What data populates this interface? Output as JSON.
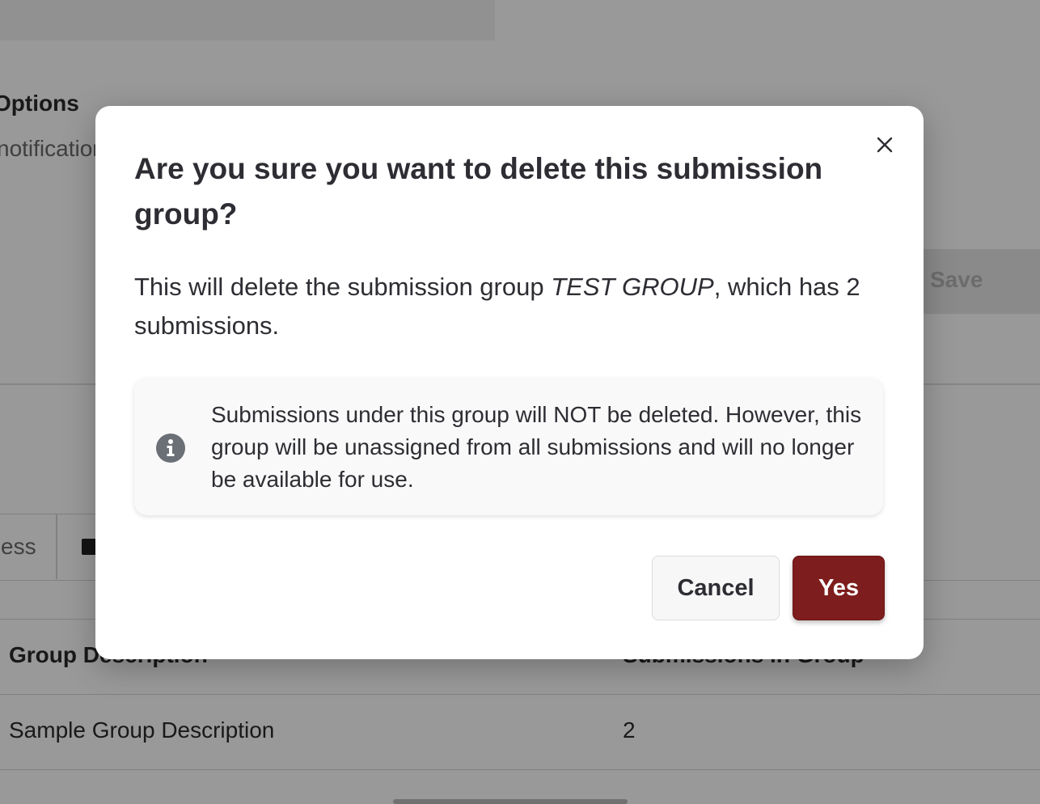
{
  "background": {
    "section_title": "Options",
    "section_subtitle": "notifications",
    "save_label": "Save",
    "tab_partial_label": "ess",
    "table": {
      "headers": [
        "Group Description",
        "Submissions in Group"
      ],
      "rows": [
        [
          "Sample Group Description",
          "2"
        ]
      ]
    }
  },
  "modal": {
    "title": "Are you sure you want to delete this submission group?",
    "body_prefix": "This will delete the submission group ",
    "group_name": "TEST GROUP",
    "body_suffix": ", which has 2 submissions.",
    "info_text": "Submissions under this group will NOT be deleted. However, this group will be unassigned from all submissions and will no longer be available for use.",
    "info_icon": "info-circle-icon",
    "close_icon": "close-icon",
    "cancel_label": "Cancel",
    "confirm_label": "Yes"
  },
  "colors": {
    "confirm_button": "#7e1d1d",
    "overlay": "rgba(0,0,0,0.40)",
    "info_icon": "#6b6f76"
  }
}
